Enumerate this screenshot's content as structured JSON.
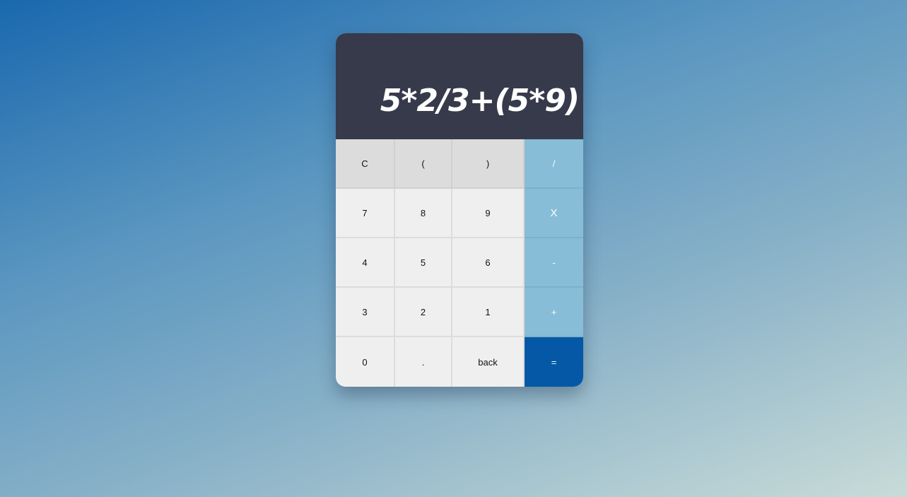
{
  "display": {
    "expression": "5*2/3+(5*9)"
  },
  "keys": {
    "clear": "C",
    "open_paren": "(",
    "close_paren": ")",
    "divide": "/",
    "seven": "7",
    "eight": "8",
    "nine": "9",
    "multiply": "X",
    "four": "4",
    "five": "5",
    "six": "6",
    "minus": "-",
    "three": "3",
    "two": "2",
    "one": "1",
    "plus": "+",
    "zero": "0",
    "dot": ".",
    "back": "back",
    "equals": "="
  },
  "colors": {
    "display_bg": "#363a4a",
    "function_key": "#dcdcdc",
    "number_key": "#efefef",
    "operator_key": "#87bdd6",
    "equals_key": "#0558a6"
  }
}
